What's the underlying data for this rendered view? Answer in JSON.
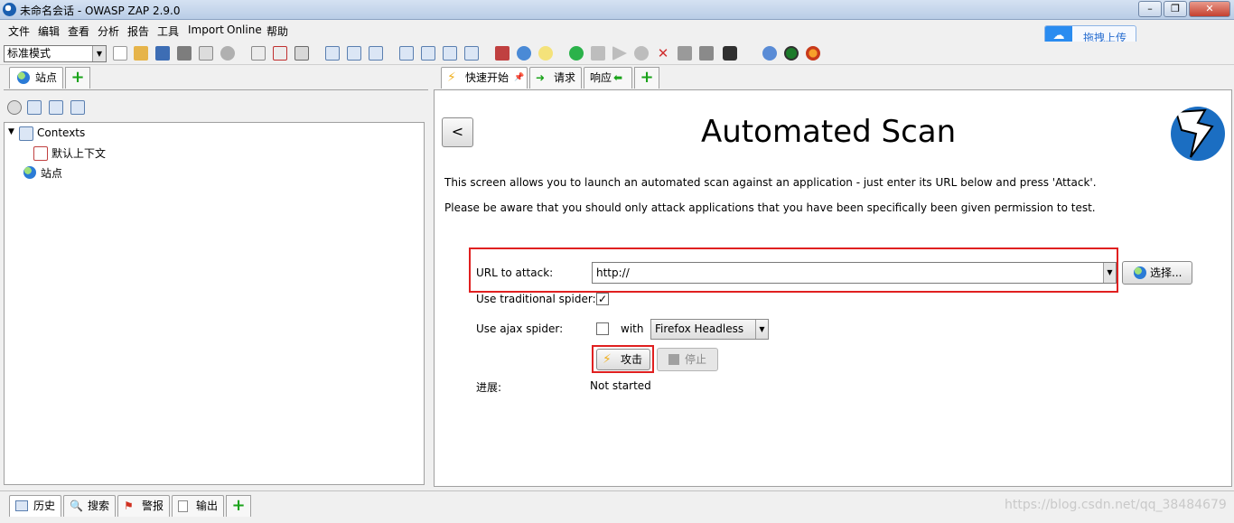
{
  "window": {
    "title": "未命名会话 - OWASP ZAP 2.9.0"
  },
  "menu": [
    "文件",
    "编辑",
    "查看",
    "分析",
    "报告",
    "工具",
    "Import",
    "Online",
    "帮助"
  ],
  "toolbar": {
    "mode": "标准模式"
  },
  "upload": {
    "label": "拖拽上传"
  },
  "left_tabs": {
    "sites_label": "站点"
  },
  "tree": {
    "contexts_label": "Contexts",
    "default_context_label": "默认上下文",
    "sites_label": "站点"
  },
  "right_tabs": {
    "quickstart_label": "快速开始",
    "request_label": "请求",
    "response_label": "响应"
  },
  "scan": {
    "back_label": "<",
    "title": "Automated Scan",
    "desc1": "This screen allows you to launch an automated scan against  an application - just enter its URL below and press 'Attack'.",
    "desc2": "Please be aware that you should only attack applications that you have been specifically been given permission to test.",
    "url_label": "URL to attack:",
    "url_value": "http://",
    "select_label": "选择...",
    "traditional_label": "Use traditional spider:",
    "traditional_checked": true,
    "ajax_label": "Use ajax spider:",
    "ajax_checked": false,
    "with_label": "with",
    "browser_value": "Firefox Headless",
    "attack_label": "攻击",
    "stop_label": "停止",
    "progress_label": "进展:",
    "progress_value": "Not started"
  },
  "bottom_tabs": {
    "history_label": "历史",
    "search_label": "搜索",
    "alerts_label": "警报",
    "output_label": "输出"
  },
  "watermark": "https://blog.csdn.net/qq_38484679"
}
